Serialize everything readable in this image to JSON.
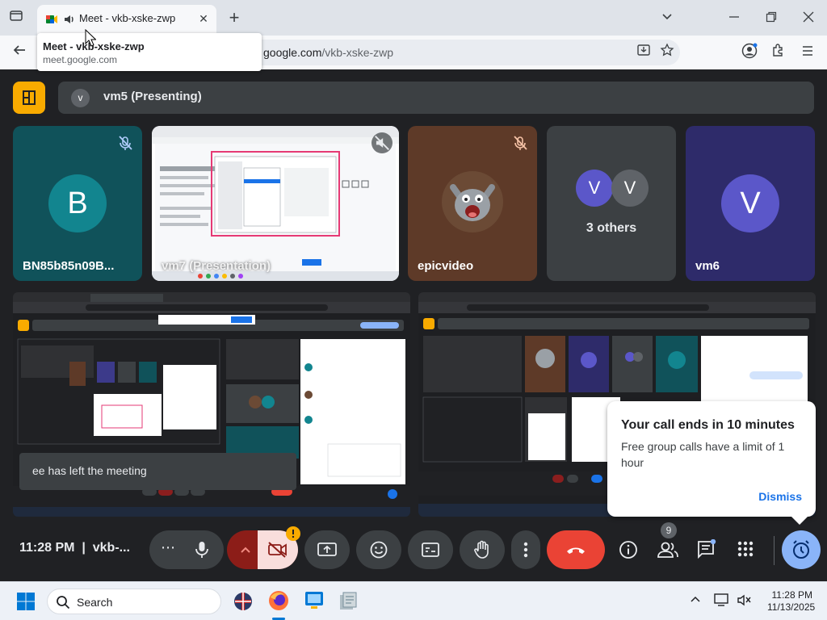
{
  "browser": {
    "tab_title": "Meet - vkb-xske-zwp",
    "url_host": "google.com",
    "url_path": "/vkb-xske-zwp",
    "tooltip_title": "Meet - vkb-xske-zwp",
    "tooltip_domain": "meet.google.com"
  },
  "meet": {
    "presenting_avatar": "v",
    "presenting_label": "vm5 (Presenting)",
    "tiles": [
      {
        "name": "BN85b85n09B...",
        "initial": "B"
      },
      {
        "name": "vm7 (Presentation)"
      },
      {
        "name": "epicvideo"
      },
      {
        "name": "3 others",
        "initials": [
          "V",
          "V"
        ]
      },
      {
        "name": "vm6",
        "initial": "V"
      }
    ],
    "notice": "ee has left the meeting",
    "call_end": {
      "title": "Your call ends in 10 minutes",
      "body": "Free group calls have a limit of 1 hour",
      "dismiss": "Dismiss"
    },
    "controls": {
      "time": "11:28 PM",
      "meeting_code": "vkb-...",
      "people_count": "9"
    }
  },
  "taskbar": {
    "search_label": "Search",
    "time": "11:28 PM",
    "date": "11/13/2025"
  },
  "colors": {
    "accent_blue": "#1a73e8",
    "hangup_red": "#ea4335",
    "meet_bg": "#202124",
    "control_bg": "#3c4043",
    "present_yellow": "#f9ab00",
    "avatar_teal": "#12858f",
    "avatar_purple": "#5b57c9"
  }
}
